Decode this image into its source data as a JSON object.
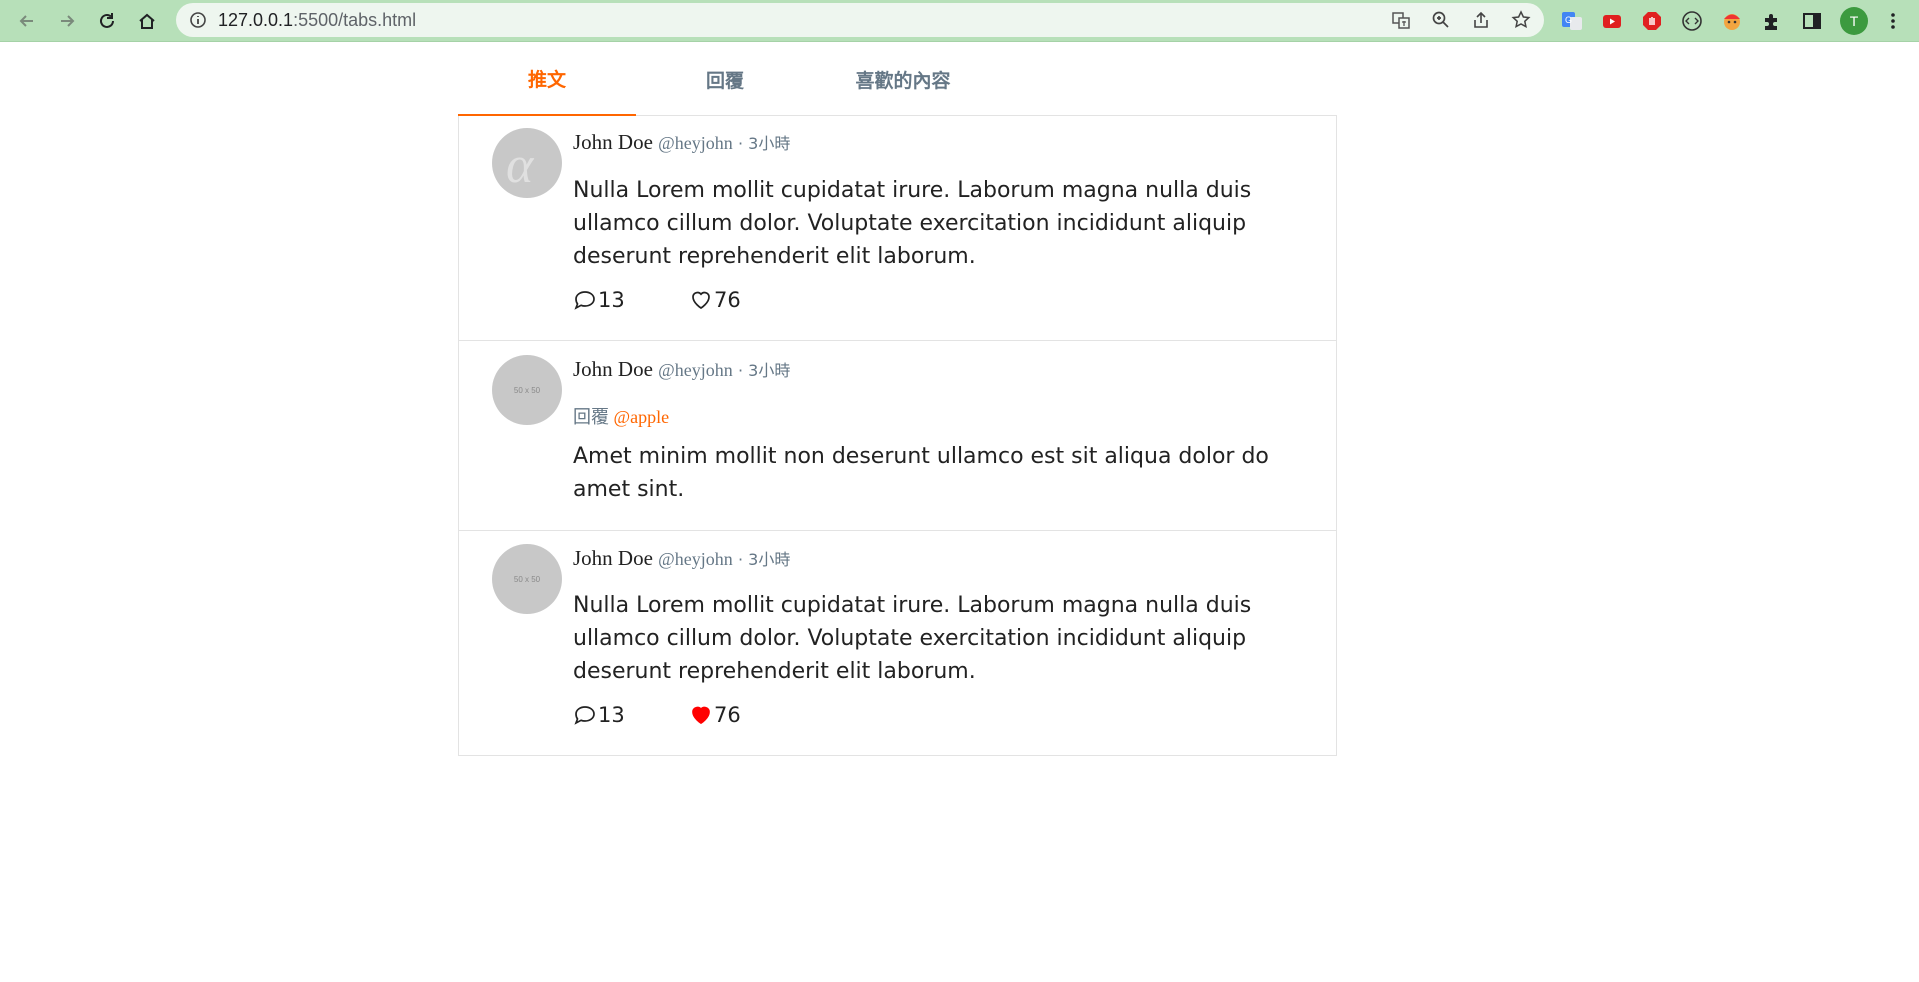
{
  "browser": {
    "url_host": "127.0.0.1",
    "url_rest": ":5500/tabs.html",
    "profile_initial": "T"
  },
  "tabs": [
    {
      "label": "推文",
      "active": true
    },
    {
      "label": "回覆",
      "active": false
    },
    {
      "label": "喜歡的內容",
      "active": false
    }
  ],
  "tweets": [
    {
      "name": "John Doe",
      "handle": "@heyjohn",
      "time": "3小時",
      "text": "Nulla Lorem mollit cupidatat irure. Laborum magna nulla duis ullamco cillum dolor. Voluptate exercitation incididunt aliquip deserunt reprehenderit elit laborum.",
      "comments": "13",
      "likes": "76",
      "liked": false
    },
    {
      "name": "John Doe",
      "handle": "@heyjohn",
      "time": "3小時",
      "reply_prefix": "回覆",
      "reply_to": "@apple",
      "text": "Amet minim mollit non deserunt ullamco est sit aliqua dolor do amet sint.",
      "avatar_placeholder": "50 x 50"
    },
    {
      "name": "John Doe",
      "handle": "@heyjohn",
      "time": "3小時",
      "text": "Nulla Lorem mollit cupidatat irure. Laborum magna nulla duis ullamco cillum dolor. Voluptate exercitation incididunt aliquip deserunt reprehenderit elit laborum.",
      "comments": "13",
      "likes": "76",
      "liked": true,
      "avatar_placeholder": "50 x 50"
    }
  ],
  "colors": {
    "accent": "#ff6600",
    "liked": "#ff0000",
    "muted": "#657786",
    "chrome": "#b7e0b9"
  }
}
